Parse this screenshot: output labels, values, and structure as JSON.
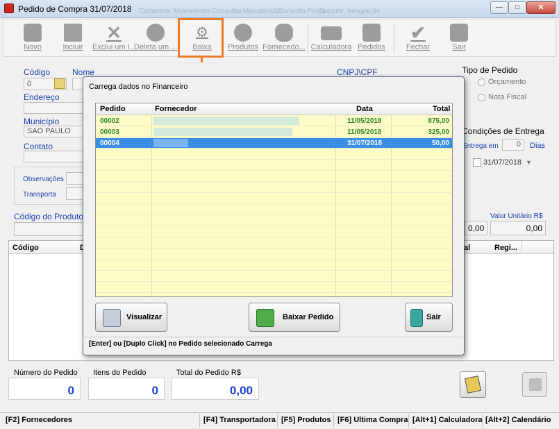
{
  "window": {
    "title": "Pedido de Compra 31/07/2018",
    "menu_ghost": [
      "Cadastros",
      "Movimentos",
      "Consultas",
      "Manutenção",
      "Consulta Preço",
      "Suporte",
      "Integração"
    ],
    "min": "—",
    "max": "□",
    "close": "✕"
  },
  "toolbar": [
    {
      "label": "Novo"
    },
    {
      "label": "Incluir"
    },
    {
      "label": "Exclui um I..."
    },
    {
      "label": "Deleta um ..."
    },
    {
      "label": "Baixa"
    },
    {
      "label": "Produtos"
    },
    {
      "label": "Fornecedo..."
    },
    {
      "label": "Calculadora"
    },
    {
      "label": "Pedidos"
    },
    {
      "label": "Fechar"
    },
    {
      "label": "Sair"
    }
  ],
  "form": {
    "codigo_label": "Código",
    "codigo_value": "0",
    "nome_label": "Nome",
    "endereco_label": "Endereço",
    "municipio_label": "Município",
    "municipio_value": "SAO PAULO",
    "contato_label": "Contato",
    "cnpj_label": "CNPJ\\CPF",
    "observacoes_label": "Observações",
    "transporta_label": "Transporta",
    "codigo_produto_label": "Código do Produto",
    "valor_unitario_label": "Valor Unitário R$",
    "valor_a": "0,00",
    "valor_b": "0,00"
  },
  "tipo_pedido": {
    "label": "Tipo de Pedido",
    "orcamento": "Orçamento",
    "nota_fiscal": "Nota Fiscal"
  },
  "entrega": {
    "label": "Condições de Entrega",
    "entrega_em": "Entrega em",
    "dias_value": "0",
    "dias": "Dias",
    "date": "31/07/2018"
  },
  "items_grid": {
    "col_codigo": "Código",
    "col_d": "D",
    "col_al": "al",
    "col_regi": "Regi..."
  },
  "dialog": {
    "title": "Carrega dados no Financeiro",
    "columns": [
      "Pedido",
      "Fornecedor",
      "Data",
      "Total"
    ],
    "rows": [
      {
        "pedido": "00002",
        "data": "11/05/2018",
        "total": "875,00"
      },
      {
        "pedido": "00003",
        "data": "11/05/2018",
        "total": "325,00"
      },
      {
        "pedido": "00004",
        "data": "31/07/2018",
        "total": "50,00"
      }
    ],
    "btn_visualizar": "Visualizar",
    "btn_baixar": "Baixar Pedido",
    "btn_sair": "Sair",
    "hint": "[Enter] ou [Duplo Click] no Pedido selecionado Carrega"
  },
  "totals": {
    "numero_label": "Número do Pedido",
    "numero_value": "0",
    "itens_label": "Itens do Pedido",
    "itens_value": "0",
    "total_label": "Total do Pedido R$",
    "total_value": "0,00"
  },
  "statusbar": [
    "[F2] Fornecedores",
    "[F4] Transportadora",
    "[F5] Produtos",
    "[F6] Ultima Compra",
    "[Alt+1] Calculadora",
    "[Alt+2] Calendário"
  ],
  "colors": {
    "accent_highlight": "#f07a2a",
    "grid_bg": "#fdfbc6",
    "selected_row": "#3a8ee6",
    "label_blue": "#1a3fb0",
    "total_blue": "#1a3fd0"
  }
}
